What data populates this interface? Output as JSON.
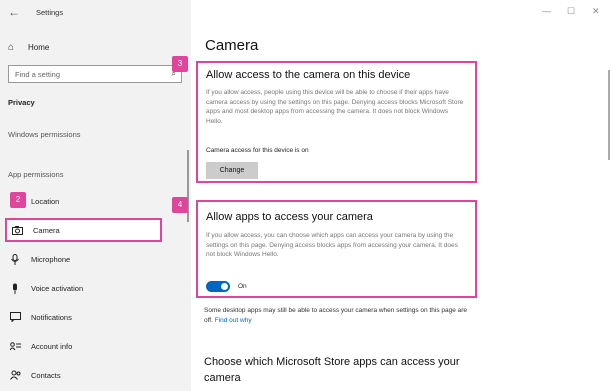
{
  "window": {
    "title": "Settings",
    "minimize": "—",
    "maximize": "☐",
    "close": "✕"
  },
  "sidebar": {
    "back": "←",
    "home_label": "Home",
    "search_placeholder": "Find a setting",
    "section_title": "Privacy",
    "windows_permissions": "Windows permissions",
    "app_permissions": "App permissions",
    "items": [
      {
        "label": "Location",
        "icon": "location-icon"
      },
      {
        "label": "Camera",
        "icon": "camera-icon"
      },
      {
        "label": "Microphone",
        "icon": "microphone-icon"
      },
      {
        "label": "Voice activation",
        "icon": "voice-icon"
      },
      {
        "label": "Notifications",
        "icon": "notifications-icon"
      },
      {
        "label": "Account info",
        "icon": "account-info-icon"
      },
      {
        "label": "Contacts",
        "icon": "contacts-icon"
      }
    ]
  },
  "main": {
    "title": "Camera",
    "device_section": {
      "heading": "Allow access to the camera on this device",
      "desc": "If you allow access, people using this device will be able to choose if their apps have camera access by using the settings on this page. Denying access blocks Microsoft Store apps and most desktop apps from accessing the camera. It does not block Windows Hello.",
      "status": "Camera access for this device is on",
      "button": "Change"
    },
    "apps_section": {
      "heading": "Allow apps to access your camera",
      "desc": "If you allow access, you can choose which apps can access your camera by using the settings on this page. Denying access blocks apps from accessing your camera. It does not block Windows Hello.",
      "toggle_label": "On"
    },
    "note": "Some desktop apps may still be able to access your camera when settings on this page are off.",
    "note_link": "Find out why",
    "store_heading": "Choose which Microsoft Store apps can access your camera"
  },
  "badges": {
    "b2": "2",
    "b3": "3",
    "b4": "4"
  },
  "colors": {
    "highlight": "#e0449b",
    "accent": "#0067c0"
  }
}
